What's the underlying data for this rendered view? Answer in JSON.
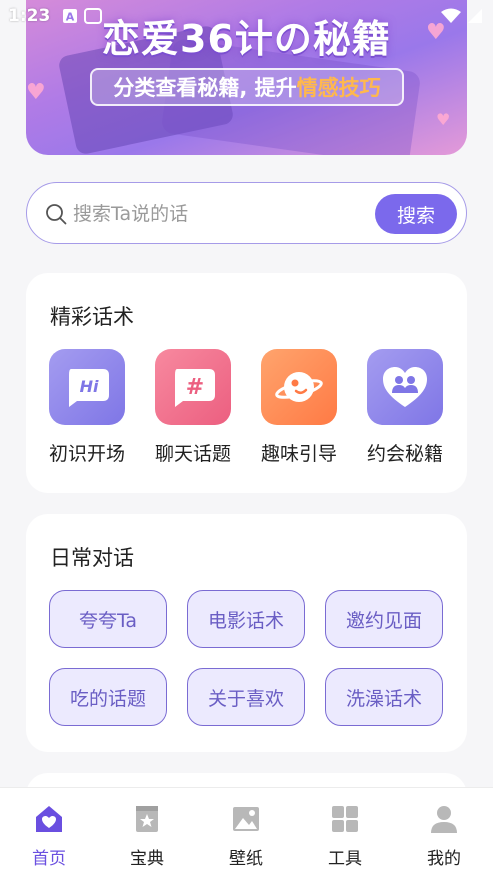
{
  "status_bar": {
    "time": "1:23"
  },
  "banner": {
    "title": "恋爱36计の秘籍",
    "subtitle_prefix": "分类查看秘籍, 提升",
    "subtitle_highlight": "情感技巧"
  },
  "search": {
    "placeholder": "搜索Ta说的话",
    "button_label": "搜索"
  },
  "features": {
    "title": "精彩话术",
    "items": [
      {
        "label": "初识开场",
        "icon": "hi-chat-icon",
        "color": "#8b82ea"
      },
      {
        "label": "聊天话题",
        "icon": "hashtag-chat-icon",
        "color": "#f06f8e"
      },
      {
        "label": "趣味引导",
        "icon": "planet-icon",
        "color": "#ff8a52"
      },
      {
        "label": "约会秘籍",
        "icon": "heart-people-icon",
        "color": "#8b82ea"
      }
    ]
  },
  "daily": {
    "title": "日常对话",
    "chips": [
      "夸夸Ta",
      "电影话术",
      "邀约见面",
      "吃的话题",
      "关于喜欢",
      "洗澡话术"
    ]
  },
  "tabbar": {
    "items": [
      {
        "label": "首页",
        "icon": "home-heart-icon",
        "active": true
      },
      {
        "label": "宝典",
        "icon": "book-star-icon",
        "active": false
      },
      {
        "label": "壁纸",
        "icon": "image-icon",
        "active": false
      },
      {
        "label": "工具",
        "icon": "grid-icon",
        "active": false
      },
      {
        "label": "我的",
        "icon": "person-icon",
        "active": false
      }
    ]
  },
  "colors": {
    "accent": "#7b69ec",
    "active_tab": "#6a4fe0"
  }
}
